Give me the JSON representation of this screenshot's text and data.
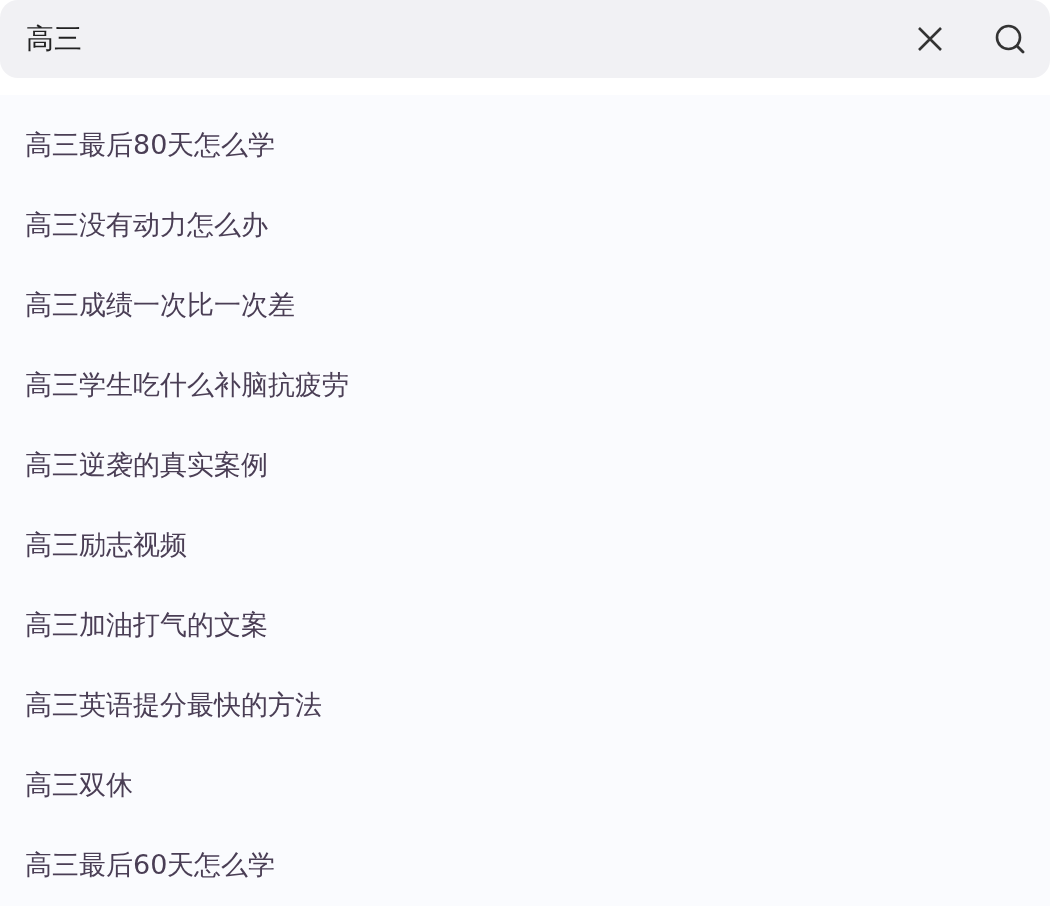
{
  "search": {
    "value": "高三"
  },
  "suggestions": [
    "高三最后80天怎么学",
    "高三没有动力怎么办",
    "高三成绩一次比一次差",
    "高三学生吃什么补脑抗疲劳",
    "高三逆袭的真实案例",
    "高三励志视频",
    "高三加油打气的文案",
    "高三英语提分最快的方法",
    "高三双休",
    "高三最后60天怎么学"
  ]
}
